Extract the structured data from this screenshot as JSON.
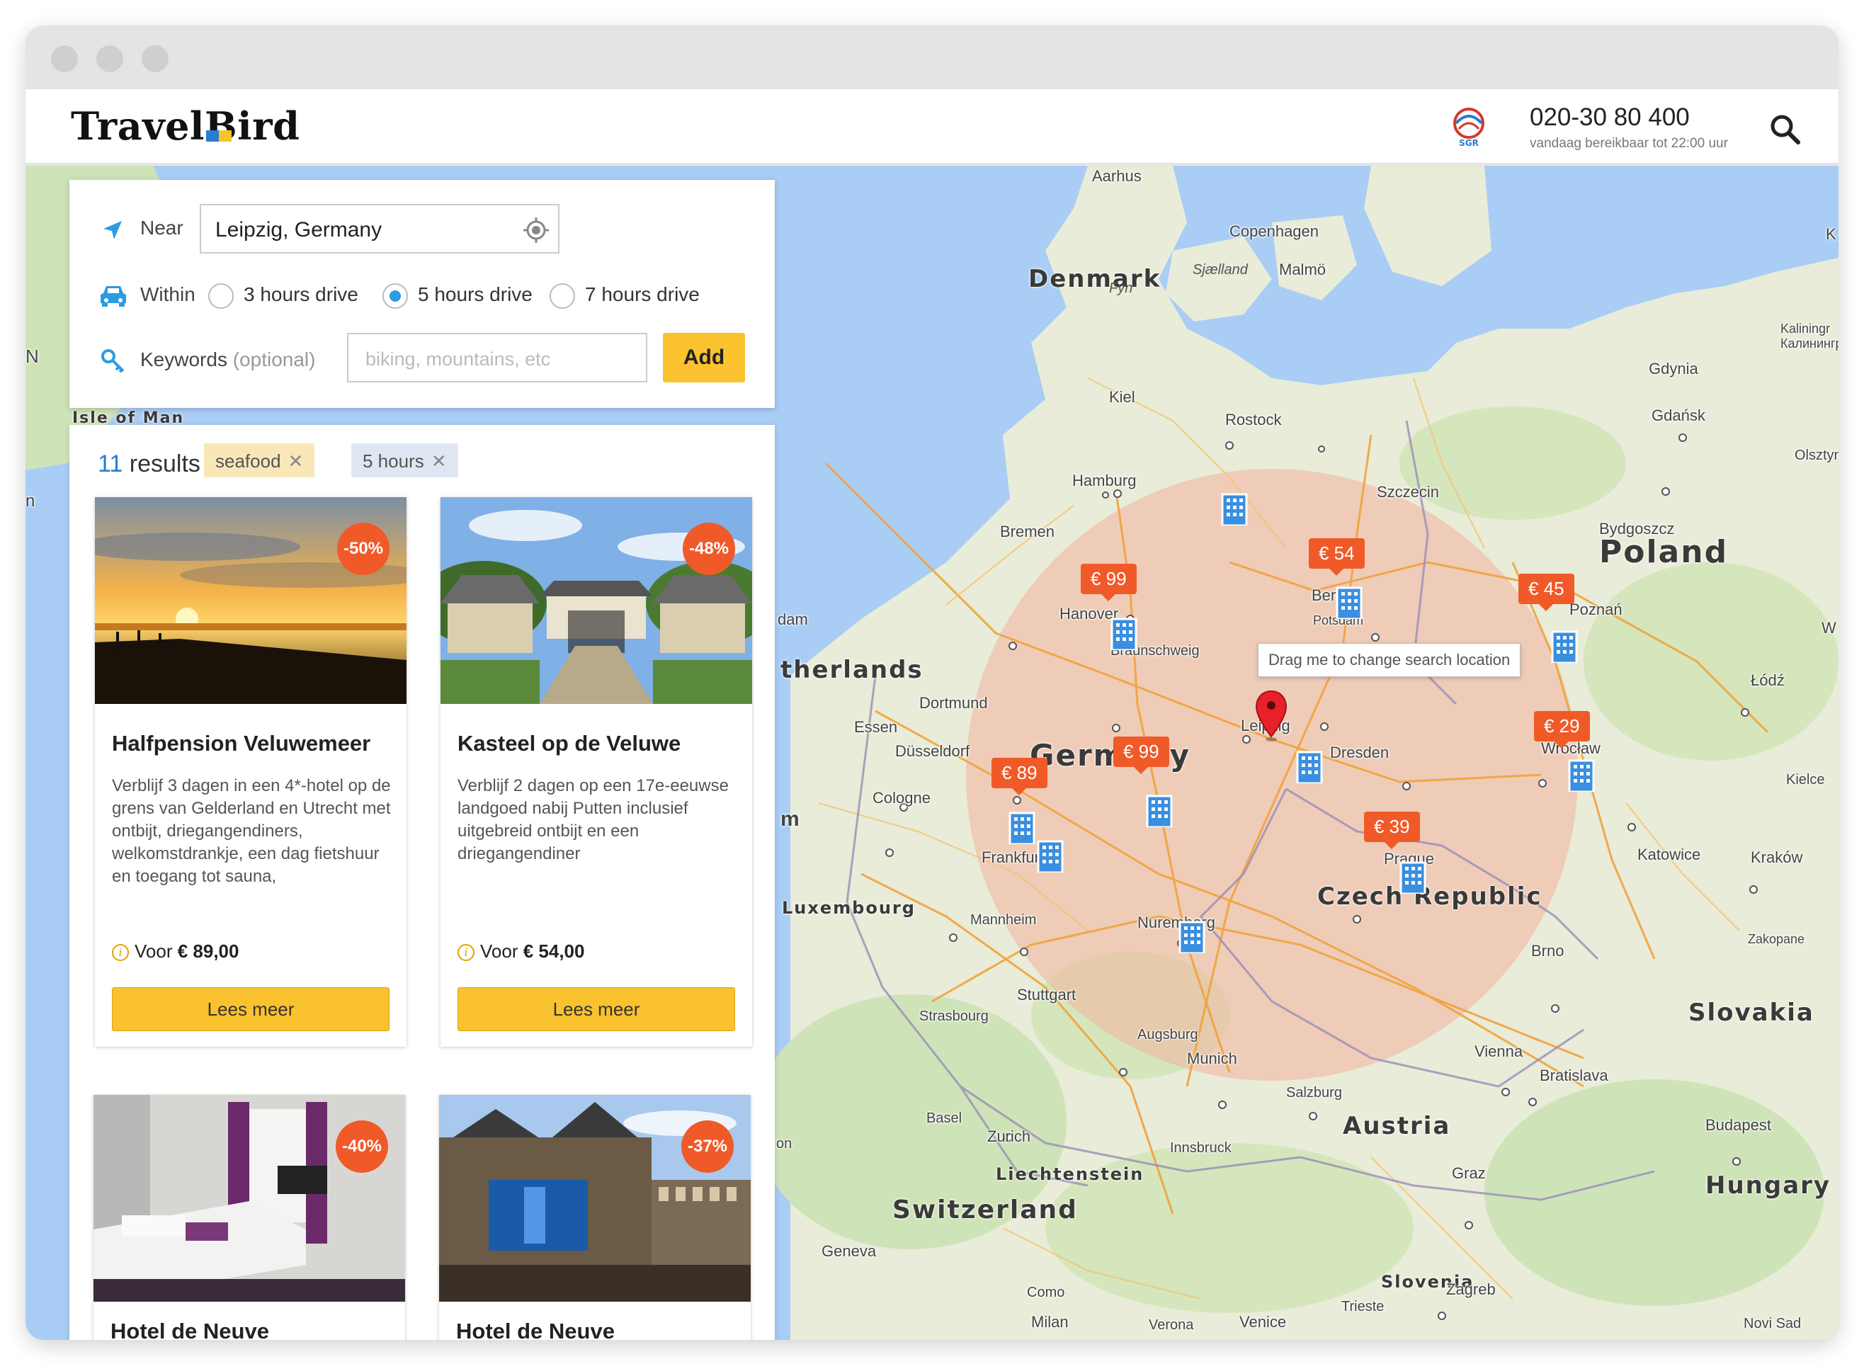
{
  "header": {
    "logo_text": "TravelBird",
    "logo_alt": "SGR",
    "phone": "020-30 80 400",
    "phone_sub": "vandaag bereikbaar tot 22:00 uur"
  },
  "search": {
    "near_label": "Near",
    "location_value": "Leipzig, Germany",
    "within_label": "Within",
    "options": [
      "3 hours drive",
      "5 hours drive",
      "7 hours drive"
    ],
    "selected_option": "5 hours drive",
    "keywords_label": "Keywords",
    "keywords_optional": "(optional)",
    "keywords_placeholder": "biking, mountains, etc",
    "add_label": "Add"
  },
  "results": {
    "count": "11",
    "count_label": "results",
    "tags": [
      "seafood",
      "5 hours"
    ],
    "cards": [
      {
        "title": "Halfpension Veluwemeer",
        "badge": "-50%",
        "description": "Verblijf 3 dagen in een 4*-hotel op de grens van Gelderland en Utrecht met ontbijt, driegangendiners, welkomstdrankje, een dag fietshuur en toegang tot sauna,",
        "price_prefix": "Voor",
        "price": "€ 89,00",
        "button": "Lees meer"
      },
      {
        "title": "Kasteel op de Veluwe",
        "badge": "-48%",
        "description": "Verblijf 2 dagen op een 17e-eeuwse landgoed nabij Putten inclusief uitgebreid ontbijt en een driegangendiner",
        "price_prefix": "Voor",
        "price": "€ 54,00",
        "button": "Lees meer"
      },
      {
        "title": "Hotel de Neuve",
        "badge": "-40%"
      },
      {
        "title": "Hotel de Neuve",
        "badge": "-37%"
      }
    ]
  },
  "map": {
    "tooltip": "Drag me to change search location",
    "prices": [
      "€ 99",
      "€ 54",
      "€ 45",
      "€ 99",
      "€ 89",
      "€ 29",
      "€ 39"
    ],
    "countries": [
      "Denmark",
      "Poland",
      "Germany",
      "Czech Republic",
      "Slovakia",
      "Austria",
      "Hungary",
      "Switzerland",
      "Liechtenstein",
      "Slovenia",
      "therlands",
      "Luxembourg",
      "Isle of Man"
    ],
    "cities": [
      "Aarhus",
      "Copenhagen",
      "Sjælland",
      "Malmö",
      "Fyn",
      "Kiel",
      "Rostock",
      "Hamburg",
      "Szczecin",
      "Gdynia",
      "Gdańsk",
      "Kaliningr Калинингр",
      "Olsztyn",
      "Bremen",
      "Hanover",
      "Braunschweig",
      "Berlin",
      "Potsdam",
      "Bydgoszcz",
      "Poznań",
      "Łódź",
      "Dortmund",
      "Essen",
      "Düsseldorf",
      "Cologne",
      "Leipzig",
      "Dresden",
      "Wrocław",
      "Frankfurt",
      "Prague",
      "Katowice",
      "Kraków",
      "Kielce",
      "Mannheim",
      "Nuremberg",
      "Brno",
      "Zakopane",
      "Stuttgart",
      "Strasbourg",
      "Augsburg",
      "Munich",
      "Vienna",
      "Bratislava",
      "Salzburg",
      "Basel",
      "Zurich",
      "Innsbruck",
      "Graz",
      "Budapest",
      "Geneva",
      "Como",
      "Milan",
      "Verona",
      "Venice",
      "Trieste",
      "Zagreb",
      "Novi Sad",
      "dam",
      "m",
      "on",
      "N",
      "n",
      "K",
      "W"
    ]
  },
  "colors": {
    "brand_yellow": "#f9c22e",
    "accent_orange": "#f05a28",
    "link_blue": "#2b7bd0",
    "radius_fill": "#f3b39e"
  }
}
